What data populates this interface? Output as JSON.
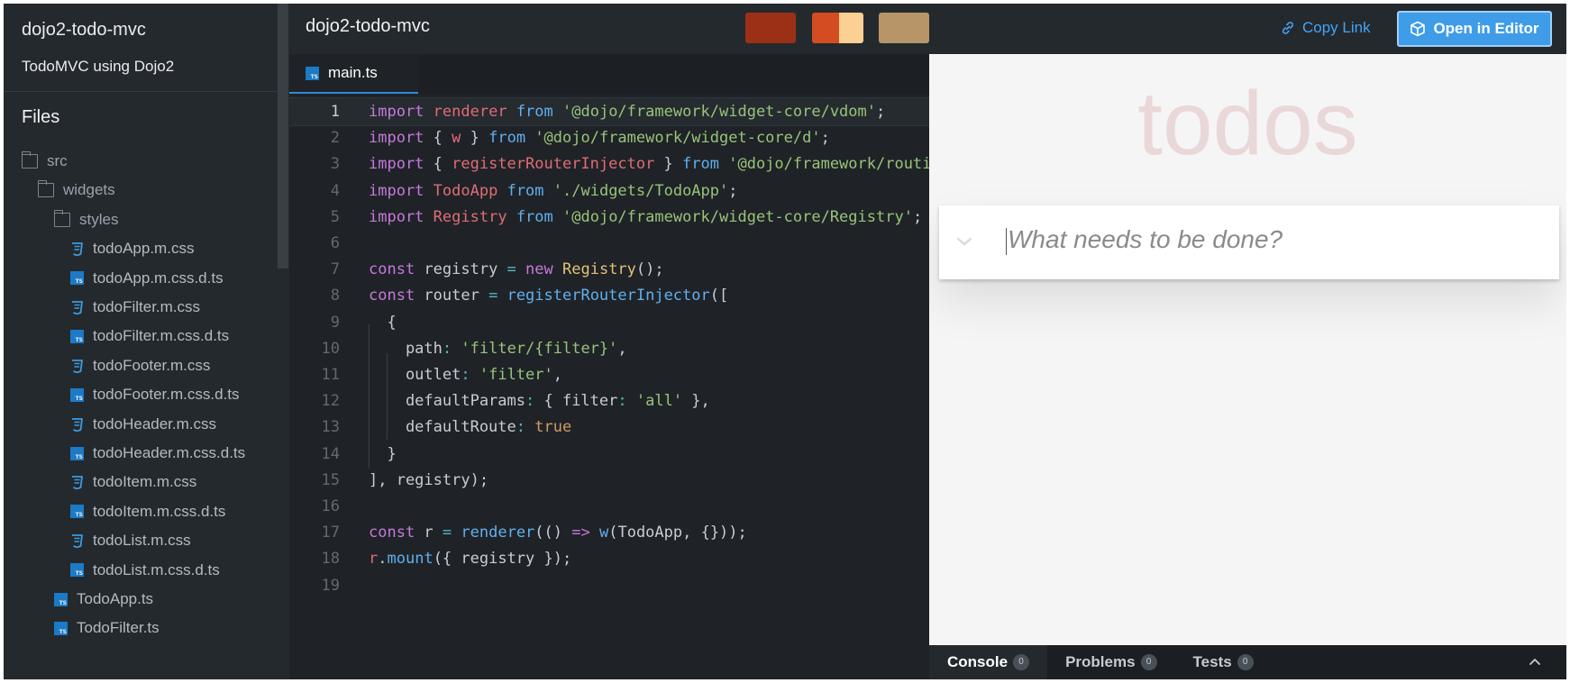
{
  "sidebar": {
    "title": "dojo2-todo-mvc",
    "subtitle": "TodoMVC using Dojo2",
    "files_heading": "Files",
    "tree": [
      {
        "label": "src",
        "type": "folder"
      },
      {
        "label": "widgets",
        "type": "folder"
      },
      {
        "label": "styles",
        "type": "folder"
      },
      {
        "label": "todoApp.m.css",
        "type": "css"
      },
      {
        "label": "todoApp.m.css.d.ts",
        "type": "ts"
      },
      {
        "label": "todoFilter.m.css",
        "type": "css"
      },
      {
        "label": "todoFilter.m.css.d.ts",
        "type": "ts"
      },
      {
        "label": "todoFooter.m.css",
        "type": "css"
      },
      {
        "label": "todoFooter.m.css.d.ts",
        "type": "ts"
      },
      {
        "label": "todoHeader.m.css",
        "type": "css"
      },
      {
        "label": "todoHeader.m.css.d.ts",
        "type": "ts"
      },
      {
        "label": "todoItem.m.css",
        "type": "css"
      },
      {
        "label": "todoItem.m.css.d.ts",
        "type": "ts"
      },
      {
        "label": "todoList.m.css",
        "type": "css"
      },
      {
        "label": "todoList.m.css.d.ts",
        "type": "ts"
      },
      {
        "label": "TodoApp.ts",
        "type": "ts"
      },
      {
        "label": "TodoFilter.ts",
        "type": "ts"
      }
    ]
  },
  "header": {
    "title": "dojo2-todo-mvc",
    "swatches": [
      "#9b3017",
      "#d44c22",
      "#fccf92",
      "#b89569"
    ],
    "copy_link": "Copy Link",
    "open_editor": "Open in Editor"
  },
  "editor": {
    "tab": "main.ts",
    "active_line": 1,
    "lines": [
      [
        [
          "k",
          "import"
        ],
        [
          "p",
          " "
        ],
        [
          "v",
          "renderer"
        ],
        [
          "p",
          " "
        ],
        [
          "f",
          "from"
        ],
        [
          "p",
          " "
        ],
        [
          "s",
          "'@dojo/framework/widget-core/vdom'"
        ],
        [
          "p",
          ";"
        ]
      ],
      [
        [
          "k",
          "import"
        ],
        [
          "p",
          " { "
        ],
        [
          "v",
          "w"
        ],
        [
          "p",
          " } "
        ],
        [
          "f",
          "from"
        ],
        [
          "p",
          " "
        ],
        [
          "s",
          "'@dojo/framework/widget-core/d'"
        ],
        [
          "p",
          ";"
        ]
      ],
      [
        [
          "k",
          "import"
        ],
        [
          "p",
          " { "
        ],
        [
          "v",
          "registerRouterInjector"
        ],
        [
          "p",
          " } "
        ],
        [
          "f",
          "from"
        ],
        [
          "p",
          " "
        ],
        [
          "s",
          "'@dojo/framework/routing/RouterInjector'"
        ],
        [
          "p",
          ";"
        ]
      ],
      [
        [
          "k",
          "import"
        ],
        [
          "p",
          " "
        ],
        [
          "v",
          "TodoApp"
        ],
        [
          "p",
          " "
        ],
        [
          "f",
          "from"
        ],
        [
          "p",
          " "
        ],
        [
          "s",
          "'./widgets/TodoApp'"
        ],
        [
          "p",
          ";"
        ]
      ],
      [
        [
          "k",
          "import"
        ],
        [
          "p",
          " "
        ],
        [
          "v",
          "Registry"
        ],
        [
          "p",
          " "
        ],
        [
          "f",
          "from"
        ],
        [
          "p",
          " "
        ],
        [
          "s",
          "'@dojo/framework/widget-core/Registry'"
        ],
        [
          "p",
          ";"
        ]
      ],
      [],
      [
        [
          "k",
          "const"
        ],
        [
          "p",
          " registry "
        ],
        [
          "o",
          "="
        ],
        [
          "p",
          " "
        ],
        [
          "k",
          "new"
        ],
        [
          "p",
          " "
        ],
        [
          "t",
          "Registry"
        ],
        [
          "p",
          "();"
        ]
      ],
      [
        [
          "k",
          "const"
        ],
        [
          "p",
          " router "
        ],
        [
          "o",
          "="
        ],
        [
          "p",
          " "
        ],
        [
          "f",
          "registerRouterInjector"
        ],
        [
          "p",
          "(["
        ]
      ],
      [
        [
          "p",
          "  {"
        ]
      ],
      [
        [
          "p",
          "    path"
        ],
        [
          "o",
          ":"
        ],
        [
          "p",
          " "
        ],
        [
          "s",
          "'filter/{filter}'"
        ],
        [
          "p",
          ","
        ]
      ],
      [
        [
          "p",
          "    outlet"
        ],
        [
          "o",
          ":"
        ],
        [
          "p",
          " "
        ],
        [
          "s",
          "'filter'"
        ],
        [
          "p",
          ","
        ]
      ],
      [
        [
          "p",
          "    defaultParams"
        ],
        [
          "o",
          ":"
        ],
        [
          "p",
          " { filter"
        ],
        [
          "o",
          ":"
        ],
        [
          "p",
          " "
        ],
        [
          "s",
          "'all'"
        ],
        [
          "p",
          " },"
        ]
      ],
      [
        [
          "p",
          "    defaultRoute"
        ],
        [
          "o",
          ":"
        ],
        [
          "p",
          " "
        ],
        [
          "n",
          "true"
        ]
      ],
      [
        [
          "p",
          "  }"
        ]
      ],
      [
        [
          "p",
          "], registry);"
        ]
      ],
      [],
      [
        [
          "k",
          "const"
        ],
        [
          "p",
          " r "
        ],
        [
          "o",
          "="
        ],
        [
          "p",
          " "
        ],
        [
          "f",
          "renderer"
        ],
        [
          "p",
          "(() "
        ],
        [
          "k",
          "=>"
        ],
        [
          "p",
          " "
        ],
        [
          "f",
          "w"
        ],
        [
          "p",
          "(TodoApp, {}));"
        ]
      ],
      [
        [
          "v",
          "r"
        ],
        [
          "p",
          "."
        ],
        [
          "f",
          "mount"
        ],
        [
          "p",
          "({ registry });"
        ]
      ],
      []
    ]
  },
  "preview": {
    "heading": "todos",
    "placeholder": "What needs to be done?"
  },
  "bottom_panel": {
    "tabs": [
      {
        "label": "Console",
        "count": "0"
      },
      {
        "label": "Problems",
        "count": "0"
      },
      {
        "label": "Tests",
        "count": "0"
      }
    ]
  }
}
